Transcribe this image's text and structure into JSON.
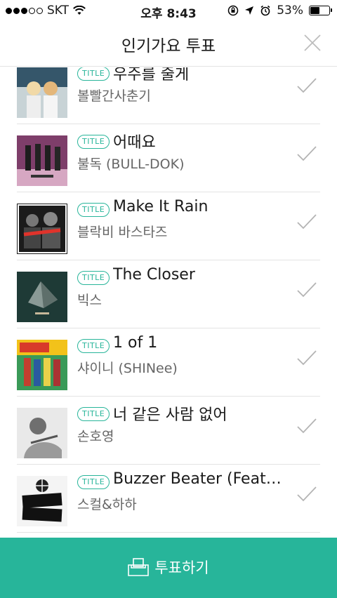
{
  "status_bar": {
    "carrier": "SKT",
    "time": "오후 8:43",
    "battery_percent": "53%",
    "battery_level": 0.53
  },
  "header": {
    "title": "인기가요 투표"
  },
  "songs": [
    {
      "badge": "TITLE",
      "title": "우주를 줄게",
      "artist": "볼빨간사춘기",
      "art_color": "#3f5f6f"
    },
    {
      "badge": "TITLE",
      "title": "어때요",
      "artist": "불독 (BULL-DOK)",
      "art_color": "#b84a83"
    },
    {
      "badge": "TITLE",
      "title": "Make It Rain",
      "artist": "블락비 바스타즈",
      "art_color": "#2a2a2a"
    },
    {
      "badge": "TITLE",
      "title": "The Closer",
      "artist": "빅스",
      "art_color": "#1f3a36"
    },
    {
      "badge": "TITLE",
      "title": "1 of 1",
      "artist": "샤이니 (SHINee)",
      "art_color": "#2f8f4f"
    },
    {
      "badge": "TITLE",
      "title": "너 같은 사람 없어",
      "artist": "손호영",
      "art_color": "#cfcfcf"
    },
    {
      "badge": "TITLE",
      "title": "Buzzer Beater (Feat....",
      "artist": "스컬&하하",
      "art_color": "#f4f4f4"
    }
  ],
  "vote_button": {
    "label": "투표하기",
    "color": "#27b59a"
  },
  "accent_color": "#28b59a"
}
